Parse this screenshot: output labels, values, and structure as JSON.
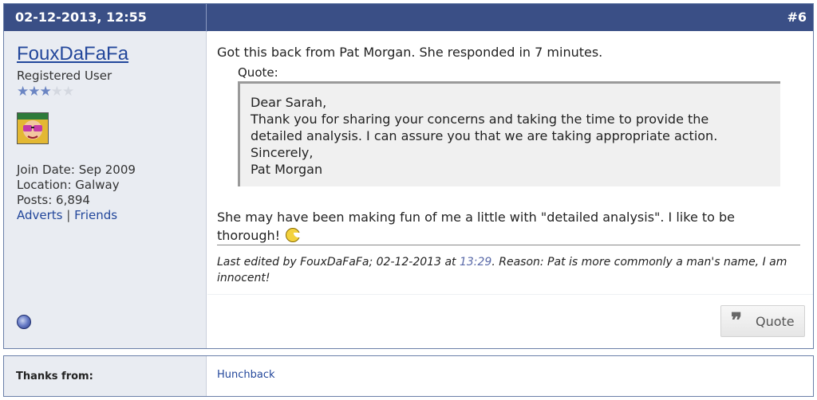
{
  "post": {
    "date": "02-12-2013, 12:55",
    "number": "#6"
  },
  "user": {
    "name": "FouxDaFaFa",
    "title": "Registered User",
    "rating_stars": 3,
    "rating_max": 5,
    "join_date": "Join Date: Sep 2009",
    "location": "Location: Galway",
    "posts": "Posts: 6,894",
    "links": [
      "Adverts",
      "Friends"
    ],
    "link_separator": "|",
    "avatar_icon": "sunglasses-avatar",
    "status_icon": "user-offline-icon"
  },
  "message": {
    "intro": "Got this back from Pat Morgan. She responded in 7 minutes.",
    "quote_label": "Quote:",
    "quote_lines": [
      "Dear Sarah,",
      "Thank you for sharing your concerns and taking the time to provide the",
      "detailed analysis. I can assure you that we are taking appropriate action.",
      "Sincerely,",
      "Pat Morgan"
    ],
    "outro_line1": "She may have been making fun of me a little with \"detailed analysis\". I like to be",
    "outro_line2": "thorough!",
    "smiley_icon": "pacman-smiley"
  },
  "edit": {
    "prefix": "Last edited by FouxDaFaFa; 02-12-2013 at ",
    "time": "13:29",
    "suffix": ". Reason: Pat is more commonly a man's name, I am innocent!"
  },
  "actions": {
    "quote_icon": "❞",
    "quote_label": "Quote"
  },
  "thanks": {
    "label": "Thanks from:",
    "names": [
      "Hunchback"
    ]
  },
  "colors": {
    "header_bg": "#3a4f86",
    "sidebar_bg": "#e9ecf2",
    "link": "#23479b"
  }
}
